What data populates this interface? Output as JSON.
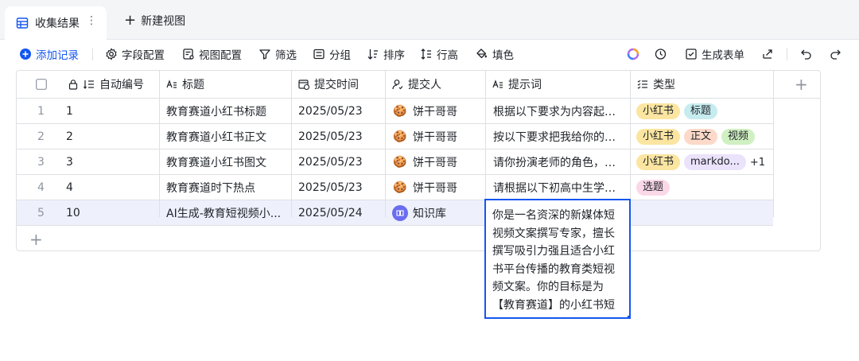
{
  "tabs": {
    "active_label": "收集结果",
    "more_icon": "⋮",
    "new_view_label": "新建视图"
  },
  "toolbar": {
    "add_record": "添加记录",
    "field_config": "字段配置",
    "view_config": "视图配置",
    "filter": "筛选",
    "group": "分组",
    "sort": "排序",
    "row_height": "行高",
    "fill": "填色",
    "generate_form": "生成表单"
  },
  "columns": {
    "auto_number": "自动编号",
    "title": "标题",
    "submit_time": "提交时间",
    "submitter": "提交人",
    "prompt": "提示词",
    "type": "类型"
  },
  "rows": [
    {
      "index": "1",
      "num": "1",
      "title": "教育赛道小红书标题",
      "time": "2025/05/23",
      "submitter": "饼干哥哥",
      "prompt": "根据以下要求为内容起…",
      "tags": [
        {
          "text": "小红书",
          "color": "yellow"
        },
        {
          "text": "标题",
          "color": "teal"
        }
      ],
      "extra": ""
    },
    {
      "index": "2",
      "num": "2",
      "title": "教育赛道小红书正文",
      "time": "2025/05/23",
      "submitter": "饼干哥哥",
      "prompt": "按以下要求把我给你的…",
      "tags": [
        {
          "text": "小红书",
          "color": "yellow"
        },
        {
          "text": "正文",
          "color": "orange"
        },
        {
          "text": "视频",
          "color": "green"
        }
      ],
      "extra": ""
    },
    {
      "index": "3",
      "num": "3",
      "title": "教育赛道小红书图文",
      "time": "2025/05/23",
      "submitter": "饼干哥哥",
      "prompt": "请你扮演老师的角色，…",
      "tags": [
        {
          "text": "小红书",
          "color": "yellow"
        },
        {
          "text": "markdo...",
          "color": "purple"
        }
      ],
      "extra": "+1"
    },
    {
      "index": "4",
      "num": "4",
      "title": "教育赛道时下热点",
      "time": "2025/05/23",
      "submitter": "饼干哥哥",
      "prompt": "请根据以下初高中生学…",
      "tags": [
        {
          "text": "选题",
          "color": "pink"
        }
      ],
      "extra": ""
    },
    {
      "index": "5",
      "num": "10",
      "title": "AI生成-教育短视频小...",
      "time": "2025/05/24",
      "submitter": "知识库",
      "prompt": "",
      "tags": [],
      "extra": ""
    }
  ],
  "editor_text": "你是一名资深的新媒体短视频文案撰写专家，擅长撰写吸引力强且适合小红书平台传播的教育类短视频文案。你的目标是为【教育赛道】的小红书短视频内容设计富有传播力、抓住用户注意力并促进互",
  "colors": {
    "accent": "#1456f0",
    "selected_row": "#eef1fc",
    "tag_yellow": "#fbe5a0",
    "tag_teal": "#c7ecef",
    "tag_orange": "#fcd9c8",
    "tag_green": "#d0f0c2",
    "tag_purple": "#ebe2fc",
    "tag_pink": "#fbd8e8"
  }
}
